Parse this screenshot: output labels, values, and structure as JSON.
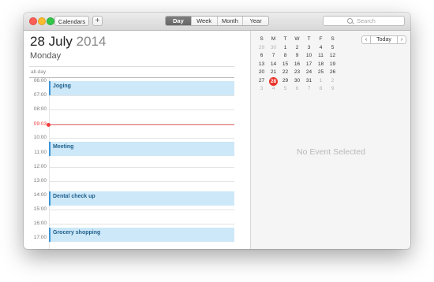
{
  "toolbar": {
    "calendars_label": "Calendars",
    "add_label": "+",
    "views": [
      {
        "label": "Day",
        "active": true
      },
      {
        "label": "Week",
        "active": false
      },
      {
        "label": "Month",
        "active": false
      },
      {
        "label": "Year",
        "active": false
      }
    ],
    "search_placeholder": "Search"
  },
  "day": {
    "date_text": "28 July",
    "year_text": "2014",
    "weekday": "Monday",
    "allday_label": "all-day"
  },
  "timeline": {
    "hours": [
      "06:00",
      "07:00",
      "08:00",
      "",
      "10:00",
      "11:00",
      "12:00",
      "13:00",
      "14:00",
      "15:00",
      "16:00",
      "17:00"
    ],
    "now_label": "09:03",
    "events": [
      {
        "title": "Joging",
        "start": "06:00",
        "end": "07:00"
      },
      {
        "title": "Meeting",
        "start": "10:15",
        "end": "11:15"
      },
      {
        "title": "Dental check up",
        "start": "13:45",
        "end": "14:45"
      },
      {
        "title": "Grocery shopping",
        "start": "16:15",
        "end": "17:15"
      }
    ]
  },
  "mini_calendar": {
    "weekdays": [
      "S",
      "M",
      "T",
      "W",
      "T",
      "F",
      "S"
    ],
    "weeks": [
      [
        {
          "d": "29",
          "dim": true
        },
        {
          "d": "30",
          "dim": true
        },
        {
          "d": "1"
        },
        {
          "d": "2"
        },
        {
          "d": "3"
        },
        {
          "d": "4"
        },
        {
          "d": "5"
        }
      ],
      [
        {
          "d": "6"
        },
        {
          "d": "7"
        },
        {
          "d": "8"
        },
        {
          "d": "9"
        },
        {
          "d": "10"
        },
        {
          "d": "11"
        },
        {
          "d": "12"
        }
      ],
      [
        {
          "d": "13"
        },
        {
          "d": "14"
        },
        {
          "d": "15"
        },
        {
          "d": "16"
        },
        {
          "d": "17"
        },
        {
          "d": "18"
        },
        {
          "d": "19"
        }
      ],
      [
        {
          "d": "20"
        },
        {
          "d": "21"
        },
        {
          "d": "22"
        },
        {
          "d": "23"
        },
        {
          "d": "24"
        },
        {
          "d": "25"
        },
        {
          "d": "26"
        }
      ],
      [
        {
          "d": "27"
        },
        {
          "d": "28",
          "today": true
        },
        {
          "d": "29"
        },
        {
          "d": "30"
        },
        {
          "d": "31"
        },
        {
          "d": "1",
          "dim": true
        },
        {
          "d": "2",
          "dim": true
        }
      ],
      [
        {
          "d": "3",
          "dim": true
        },
        {
          "d": "4",
          "dim": true
        },
        {
          "d": "5",
          "dim": true
        },
        {
          "d": "6",
          "dim": true
        },
        {
          "d": "7",
          "dim": true
        },
        {
          "d": "8",
          "dim": true
        },
        {
          "d": "9",
          "dim": true
        }
      ]
    ],
    "today_button": "Today",
    "prev_glyph": "‹",
    "next_glyph": "›"
  },
  "detail": {
    "empty_text": "No Event Selected"
  },
  "colors": {
    "event_fill": "#cde8f8",
    "event_border": "#3a95d6",
    "now_red": "#f03c3c",
    "today_red": "#e9352b"
  }
}
